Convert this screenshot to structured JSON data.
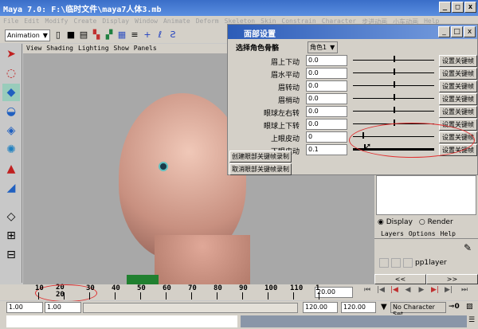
{
  "window": {
    "title": "Maya 7.0: F:\\临时文件\\maya7人体3.mb",
    "min": "_",
    "max": "□",
    "close": "x"
  },
  "menu": [
    "File",
    "Edit",
    "Modify",
    "Create",
    "Display",
    "Window",
    "Animate",
    "Deform",
    "Skeleton",
    "Skin",
    "Constrain",
    "Character",
    "步进动画",
    "小车动画",
    "Help"
  ],
  "toolbar": {
    "mode": "Animation"
  },
  "viewport_menu": [
    "View",
    "Shading",
    "Lighting",
    "Show",
    "Panels"
  ],
  "dialog": {
    "title": "面部设置",
    "select_label": "选择角色骨骼",
    "select_value": "角色1",
    "rows": [
      {
        "label": "眉上下动",
        "value": "0.0",
        "slider": 0.5,
        "button": "设置关键帧"
      },
      {
        "label": "眉水平动",
        "value": "0.0",
        "slider": 0.5,
        "button": "设置关键帧"
      },
      {
        "label": "眉转动",
        "value": "0.0",
        "slider": 0.5,
        "button": "设置关键帧"
      },
      {
        "label": "眉梢动",
        "value": "0.0",
        "slider": 0.5,
        "button": "设置关键帧"
      },
      {
        "label": "眼球左右转",
        "value": "0.0",
        "slider": 0.5,
        "button": "设置关键帧"
      },
      {
        "label": "眼球上下转",
        "value": "0.0",
        "slider": 0.5,
        "button": "设置关键帧"
      },
      {
        "label": "上眼皮动",
        "value": "0",
        "slider": 0.12,
        "button": "设置关键帧"
      },
      {
        "label": "下眼皮动",
        "value": "0.1",
        "slider": 0.14,
        "button": "设置关键帧"
      }
    ],
    "create_button": "创建眼部关键帧录制",
    "cancel_button": "取消眼部关键帧录制"
  },
  "layers": {
    "display": "Display",
    "render": "Render",
    "menu": [
      "Layers",
      "Options",
      "Help"
    ],
    "layer_name": "pp1layer",
    "prev": "<<",
    "next": ">>"
  },
  "timeline": {
    "ticks": [
      "10",
      "20",
      "30",
      "40",
      "50",
      "60",
      "70",
      "80",
      "90",
      "100",
      "110",
      "1"
    ],
    "current_marker": "20",
    "current_time": "20.00"
  },
  "range": {
    "start": "1.00",
    "start2": "1.00",
    "end": "120.00",
    "end2": "120.00",
    "character_set": "No Character Set"
  },
  "highlight_color": "#e03030"
}
